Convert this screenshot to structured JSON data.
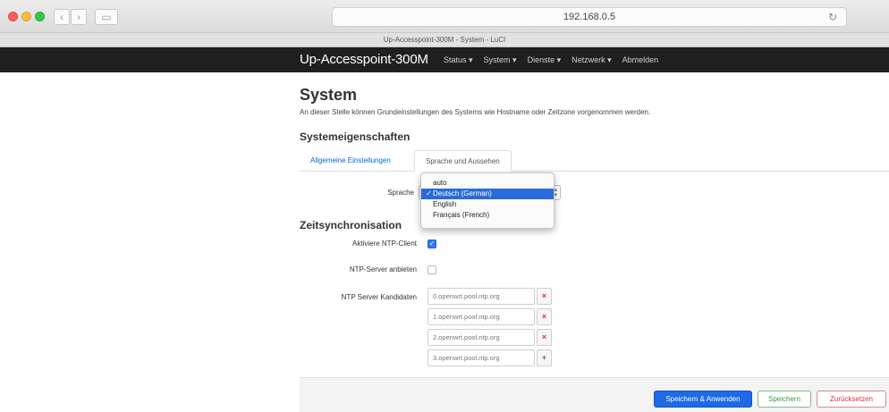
{
  "browser": {
    "url": "192.168.0.5",
    "tab_title": "Up-Accesspoint-300M - System - LuCI",
    "reload_icon": "reload-icon"
  },
  "header": {
    "brand": "Up-Accesspoint-300M",
    "menu": [
      {
        "label": "Status ▾"
      },
      {
        "label": "System ▾"
      },
      {
        "label": "Dienste ▾"
      },
      {
        "label": "Netzwerk ▾"
      },
      {
        "label": "Abmelden"
      }
    ]
  },
  "page": {
    "title": "System",
    "description": "An dieser Stelle können Grundeinstellungen des Systems wie Hostname oder Zeitzone vorgenommen werden."
  },
  "properties": {
    "title": "Systemeigenschaften",
    "tabs": [
      {
        "label": "Allgemeine Einstellungen",
        "active": false
      },
      {
        "label": "Sprache und Aussehen",
        "active": true
      }
    ],
    "language_label": "Sprache",
    "language_options": [
      {
        "label": "auto",
        "selected": false
      },
      {
        "label": "Deutsch (German)",
        "selected": true,
        "check": "✓"
      },
      {
        "label": "English",
        "selected": false
      },
      {
        "label": "Français (French)",
        "selected": false
      }
    ]
  },
  "timesync": {
    "title": "Zeitsynchronisation",
    "ntp_client_label": "Aktiviere NTP-Client",
    "ntp_client_checked": true,
    "ntp_server_label": "NTP-Server anbieten",
    "ntp_server_checked": false,
    "candidates_label": "NTP Server Kandidaten",
    "servers": [
      {
        "value": "0.openwrt.pool.ntp.org",
        "action": "×"
      },
      {
        "value": "1.openwrt.pool.ntp.org",
        "action": "×"
      },
      {
        "value": "2.openwrt.pool.ntp.org",
        "action": "×"
      },
      {
        "value": "3.openwrt.pool.ntp.org",
        "action": "+"
      }
    ]
  },
  "footer": {
    "apply_label": "Speichern & Anwenden",
    "save_label": "Speichern",
    "reset_label": "Zurücksetzen"
  },
  "colors": {
    "primary": "#1e6ae8",
    "header_bg": "#1f1f1f",
    "link": "#0069d6",
    "remove": "#d43434",
    "add": "#3a9a3a"
  }
}
